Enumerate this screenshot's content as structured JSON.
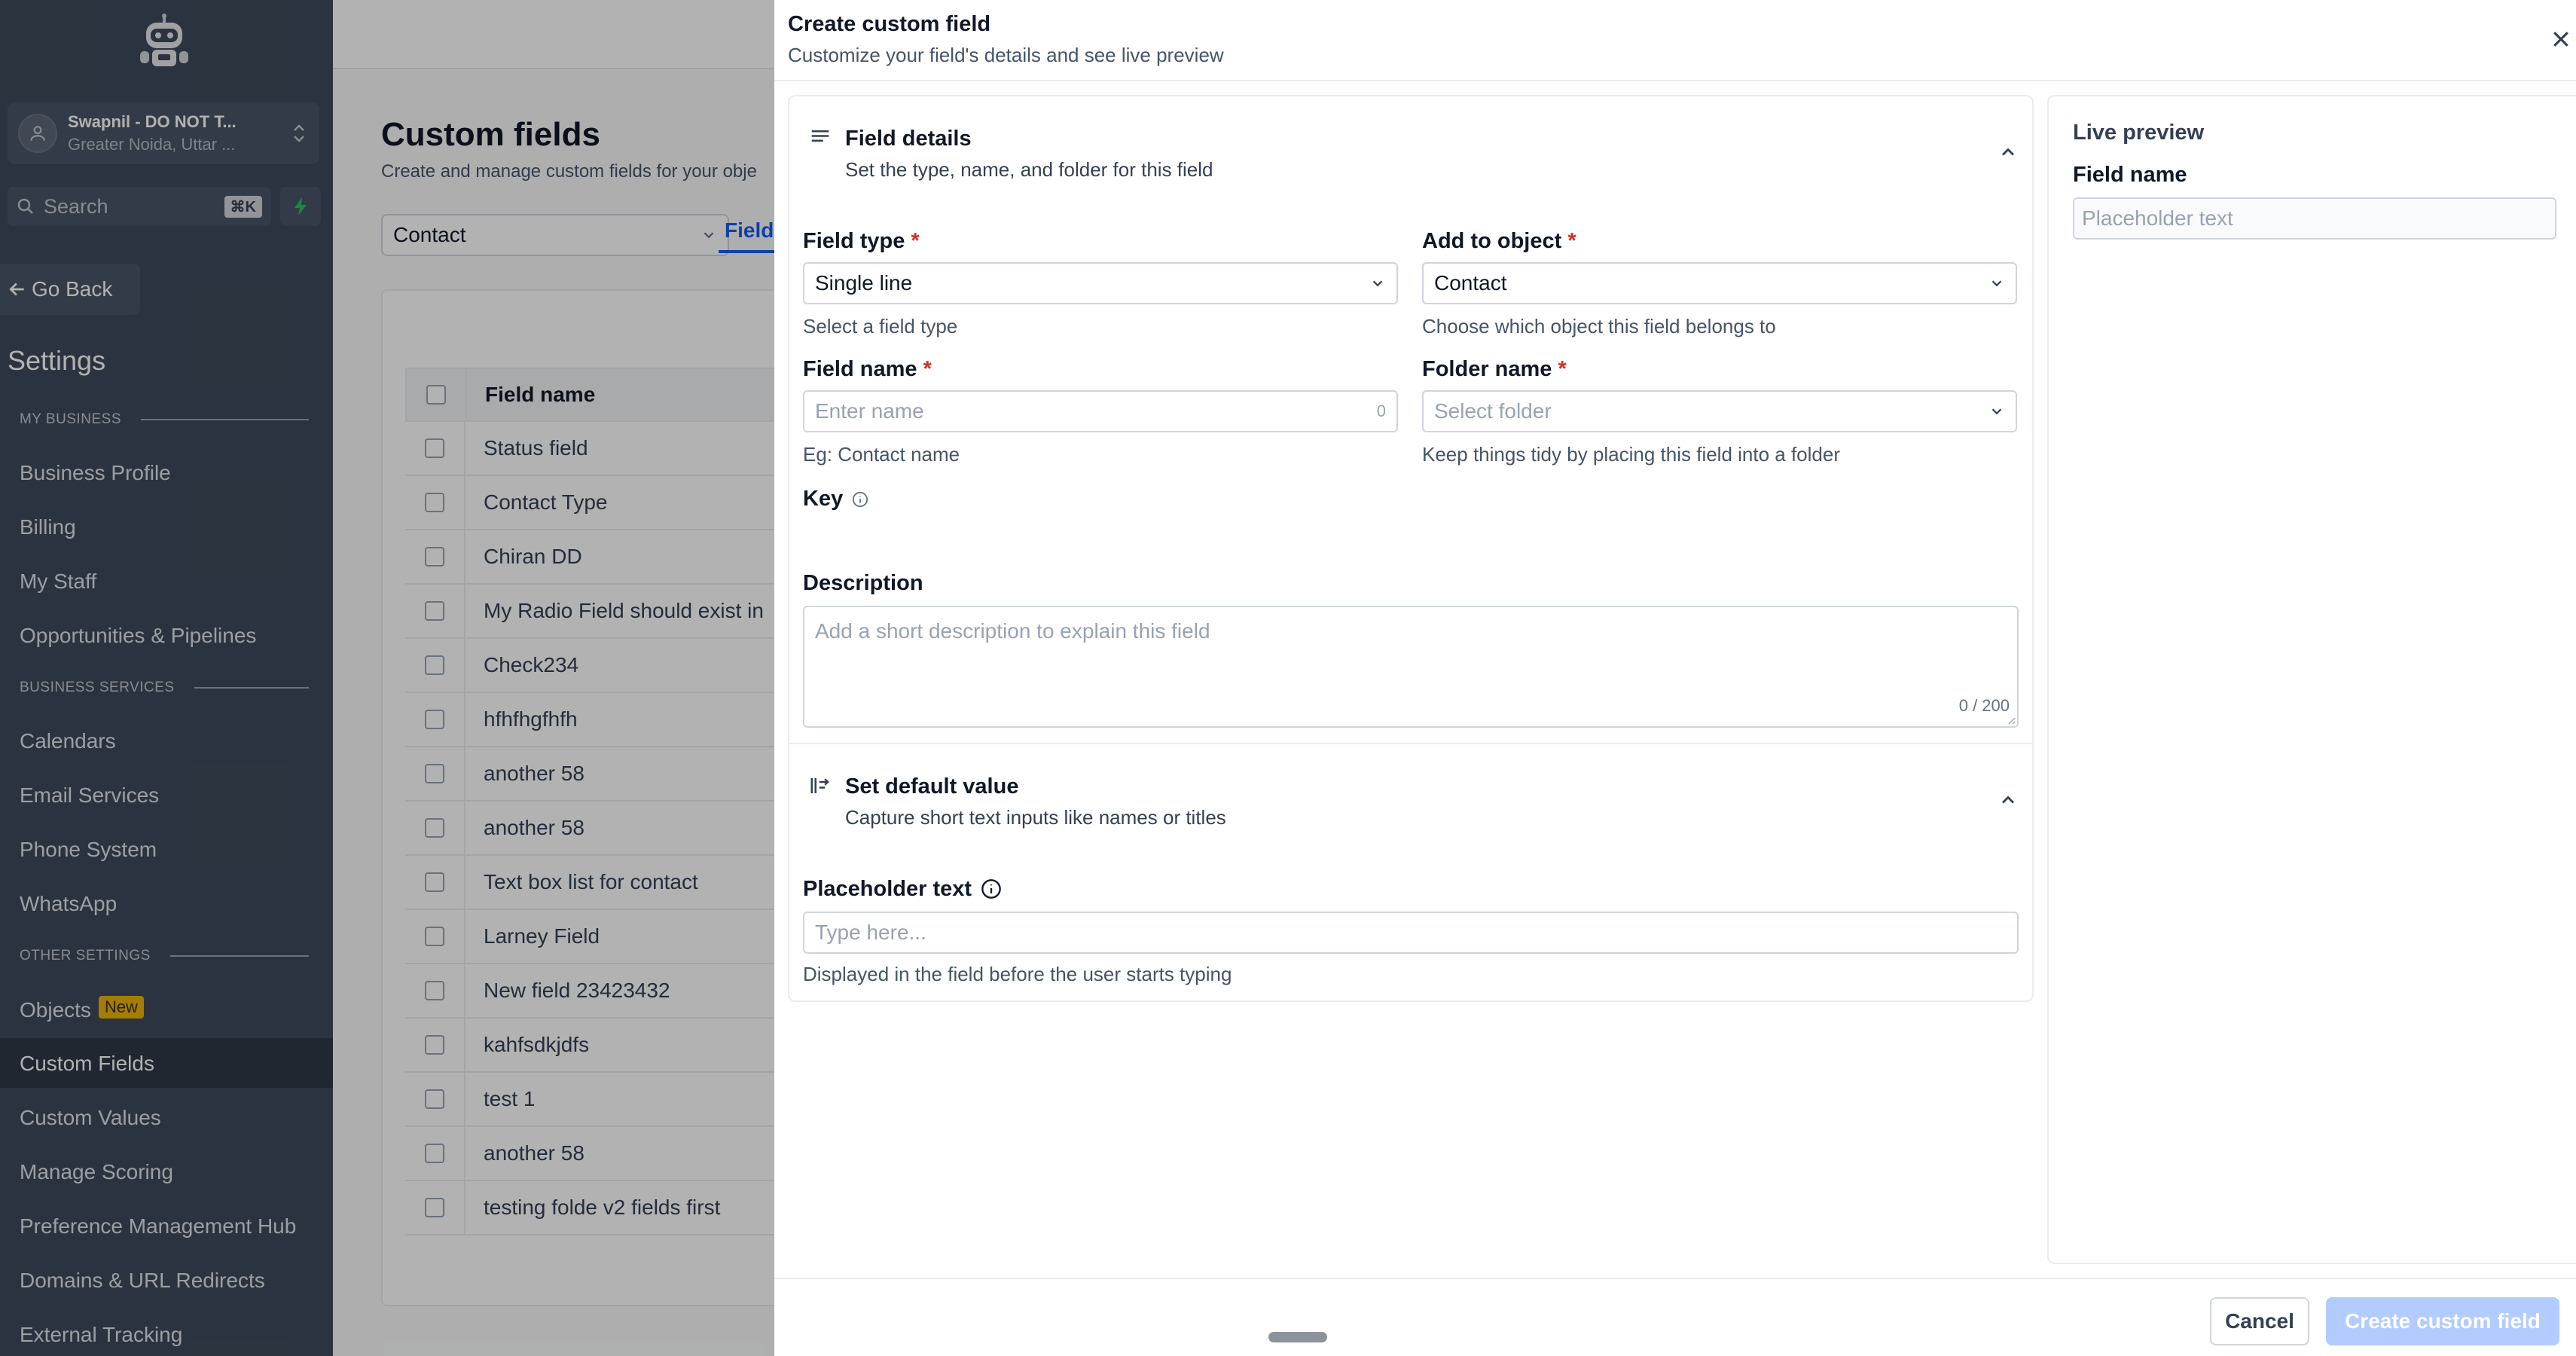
{
  "sidebar": {
    "account": {
      "name": "Swapnil - DO NOT T...",
      "location": "Greater Noida, Uttar ..."
    },
    "search": {
      "placeholder": "Search",
      "shortcut": "⌘K"
    },
    "go_back": "Go Back",
    "settings_title": "Settings",
    "sections": {
      "my_business": "MY BUSINESS",
      "business_services": "BUSINESS SERVICES",
      "other_settings": "OTHER SETTINGS"
    },
    "items": [
      "Business Profile",
      "Billing",
      "My Staff",
      "Opportunities & Pipelines",
      "Calendars",
      "Email Services",
      "Phone System",
      "WhatsApp",
      "Objects",
      "Custom Fields",
      "Custom Values",
      "Manage Scoring",
      "Preference Management Hub",
      "Domains & URL Redirects",
      "External Tracking"
    ],
    "objects_badge": "New",
    "active_item": "Custom Fields"
  },
  "main": {
    "title": "Custom fields",
    "subtitle": "Create and manage custom fields for your obje",
    "object_select": "Contact",
    "tab_fields": "Fields",
    "table": {
      "header": "Field name",
      "rows": [
        "Status field",
        "Contact Type",
        "Chiran DD",
        "My Radio Field should exist in",
        "Check234",
        "hfhfhgfhfh",
        "another 58",
        "another 58",
        "Text box list for contact",
        "Larney Field",
        "New field 23423432",
        "kahfsdkjdfs",
        "test 1",
        "another 58",
        "testing folde v2 fields first"
      ]
    }
  },
  "drawer": {
    "title": "Create custom field",
    "subtitle": "Customize your field's details and see live preview",
    "field_details": {
      "title": "Field details",
      "subtitle": "Set the type, name, and folder for this field",
      "field_type": {
        "label": "Field type",
        "value": "Single line",
        "hint": "Select a field type"
      },
      "add_to_object": {
        "label": "Add to object",
        "value": "Contact",
        "hint": "Choose which object this field belongs to"
      },
      "field_name": {
        "label": "Field name",
        "placeholder": "Enter name",
        "count": "0",
        "hint": "Eg: Contact name"
      },
      "folder_name": {
        "label": "Folder name",
        "placeholder": "Select folder",
        "hint": "Keep things tidy by placing this field into a folder"
      },
      "key_label": "Key",
      "description": {
        "label": "Description",
        "placeholder": "Add a short description to explain this field",
        "counter": "0 / 200"
      },
      "required_mark": "*"
    },
    "default_value": {
      "title": "Set default value",
      "subtitle": "Capture short text inputs like names or titles",
      "placeholder_label": "Placeholder text",
      "placeholder_input": "Type here...",
      "placeholder_hint": "Displayed in the field before the user starts typing"
    },
    "live_preview": {
      "title": "Live preview",
      "field_label": "Field name",
      "field_placeholder": "Placeholder text"
    },
    "buttons": {
      "cancel": "Cancel",
      "create": "Create custom field"
    }
  },
  "colors": {
    "sidebar_bg": "#3f4a5c",
    "accent": "#155eef",
    "required": "#d92d20",
    "badge": "#eab308",
    "primary_disabled": "#b2ccff"
  }
}
